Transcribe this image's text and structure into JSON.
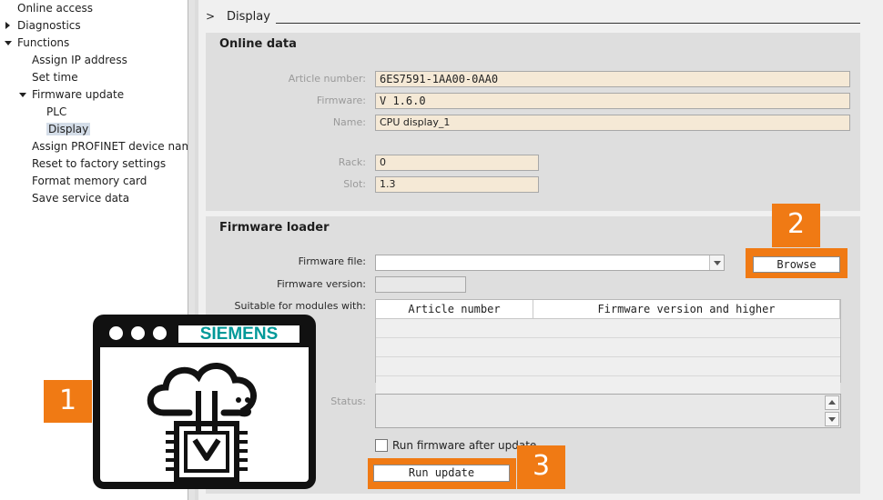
{
  "tree": {
    "items": [
      {
        "label": "Online access",
        "indent": 0,
        "expander": "none",
        "selected": false
      },
      {
        "label": "Diagnostics",
        "indent": 0,
        "expander": "collapsed",
        "selected": false
      },
      {
        "label": "Functions",
        "indent": 0,
        "expander": "expanded",
        "selected": false
      },
      {
        "label": "Assign IP address",
        "indent": 1,
        "expander": "none",
        "selected": false
      },
      {
        "label": "Set time",
        "indent": 1,
        "expander": "none",
        "selected": false
      },
      {
        "label": "Firmware update",
        "indent": 1,
        "expander": "expanded",
        "selected": false
      },
      {
        "label": "PLC",
        "indent": 2,
        "expander": "none",
        "selected": false
      },
      {
        "label": "Display",
        "indent": 2,
        "expander": "none",
        "selected": true
      },
      {
        "label": "Assign PROFINET device name",
        "indent": 1,
        "expander": "none",
        "selected": false
      },
      {
        "label": "Reset to factory settings",
        "indent": 1,
        "expander": "none",
        "selected": false
      },
      {
        "label": "Format memory card",
        "indent": 1,
        "expander": "none",
        "selected": false
      },
      {
        "label": "Save service data",
        "indent": 1,
        "expander": "none",
        "selected": false
      }
    ]
  },
  "section": {
    "chevron": ">",
    "title": "Display"
  },
  "online_data": {
    "title": "Online data",
    "article_label": "Article number:",
    "article_value": "6ES7591-1AA00-0AA0",
    "firmware_label": "Firmware:",
    "firmware_value": "V 1.6.0",
    "name_label": "Name:",
    "name_value": "CPU display_1",
    "rack_label": "Rack:",
    "rack_value": "0",
    "slot_label": "Slot:",
    "slot_value": "1.3"
  },
  "loader": {
    "title": "Firmware loader",
    "file_label": "Firmware file:",
    "file_value": "",
    "browse_label": "Browse",
    "version_label": "Firmware version:",
    "version_value": "",
    "suitable_label": "Suitable for modules with:",
    "col_article": "Article number",
    "col_firmware": "Firmware version and higher",
    "status_label": "Status:",
    "status_value": "",
    "run_after_label": "Run firmware after update",
    "run_after_checked": false,
    "run_update_label": "Run update"
  },
  "badges": {
    "one": "1",
    "two": "2",
    "three": "3"
  },
  "logo": {
    "brand": "SIEMENS"
  },
  "colors": {
    "accent": "#f07a14",
    "brand_teal": "#009999"
  }
}
